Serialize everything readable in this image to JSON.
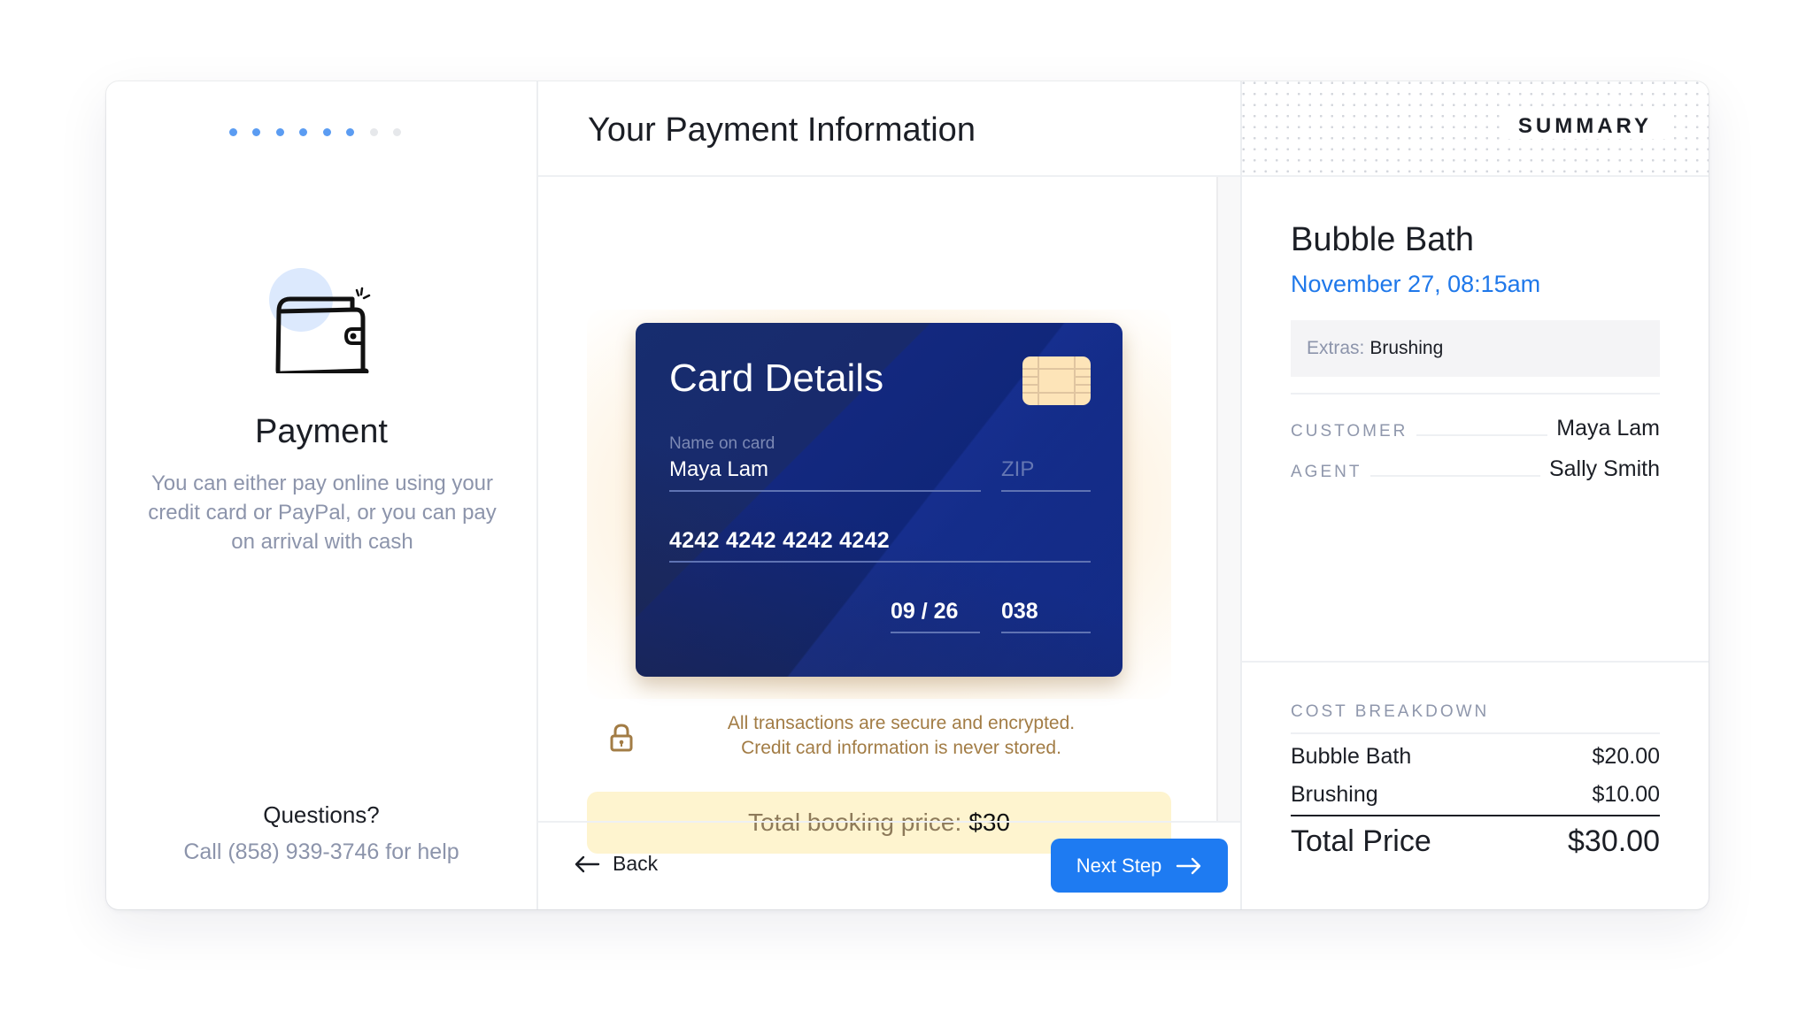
{
  "progress": {
    "current_step": 6,
    "total_steps": 8
  },
  "left": {
    "title": "Payment",
    "description": "You can either pay online using your credit card or PayPal, or you can pay on arrival with cash",
    "questions_title": "Questions?",
    "questions_text": "Call (858) 939-3746 for help",
    "illustration": "wallet-icon"
  },
  "main": {
    "title": "Your Payment Information",
    "card": {
      "title": "Card Details",
      "name_label": "Name on card",
      "name_value": "Maya Lam",
      "zip_placeholder": "ZIP",
      "number": "4242 4242 4242 4242",
      "expiry": "09 / 26",
      "cvc": "038"
    },
    "security_line1": "All transactions are secure and encrypted.",
    "security_line2": "Credit card information is never stored.",
    "total_label": "Total booking price:",
    "total_value": "$30",
    "back_label": "Back",
    "next_label": "Next Step"
  },
  "summary": {
    "header": "SUMMARY",
    "service": "Bubble Bath",
    "datetime": "November 27, 08:15am",
    "extras_label": "Extras:",
    "extras_value": "Brushing",
    "customer_label": "CUSTOMER",
    "customer_value": "Maya Lam",
    "agent_label": "AGENT",
    "agent_value": "Sally Smith",
    "cost_label": "COST BREAKDOWN",
    "items": [
      {
        "name": "Bubble Bath",
        "price": "$20.00"
      },
      {
        "name": "Brushing",
        "price": "$10.00"
      }
    ],
    "total_label": "Total Price",
    "total_value": "$30.00"
  },
  "colors": {
    "accent": "#1e7bf2",
    "step_done": "#5b9cf2",
    "card_bg": "#13287f",
    "chip": "#fde4b8",
    "security_text": "#a27c45",
    "banner_bg": "#fef4cf"
  }
}
